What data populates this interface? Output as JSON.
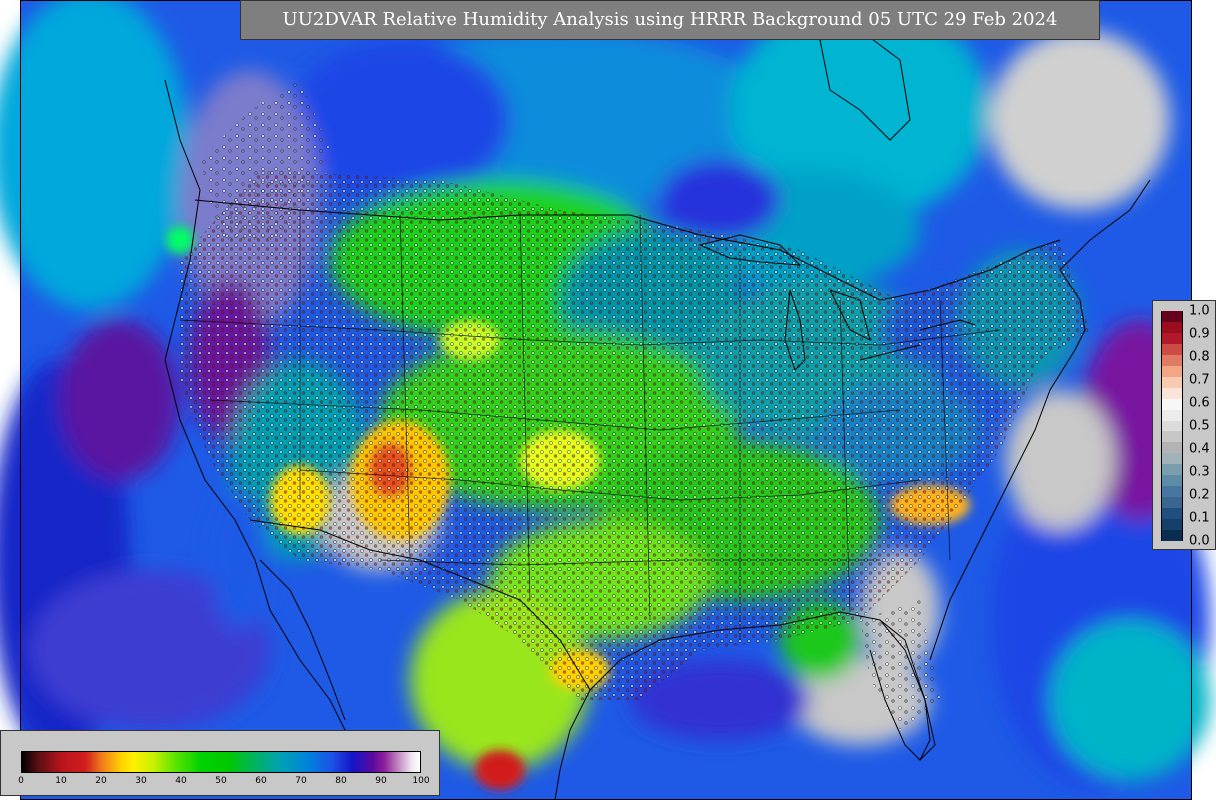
{
  "title": "UU2DVAR Relative Humidity Analysis using HRRR Background 05 UTC 29 Feb 2024",
  "rh_colorbar": {
    "ticks": [
      "0",
      "10",
      "20",
      "30",
      "40",
      "50",
      "60",
      "70",
      "80",
      "90",
      "100"
    ]
  },
  "increment_colorbar": {
    "labels": [
      "1.0",
      "0.9",
      "0.8",
      "0.7",
      "0.6",
      "0.5",
      "0.4",
      "0.3",
      "0.2",
      "0.1",
      "0.0"
    ],
    "colors": [
      "#67001f",
      "#9c0d1c",
      "#b2182b",
      "#cc4c45",
      "#e07b63",
      "#f4a582",
      "#f8cbb0",
      "#fae4d8",
      "#f7f7f7",
      "#ececec",
      "#dcdcdc",
      "#c7c7c7",
      "#b3b3b3",
      "#9fb3b8",
      "#7a9eae",
      "#5e8ca6",
      "#4776a0",
      "#3a6690",
      "#1f4f7f",
      "#163f6a",
      "#0c2d52"
    ]
  },
  "colors": {
    "ocean_blue": "#1e64e6",
    "ocean_cyan": "#00aadc",
    "ocean_purple": "#6a14a0",
    "dry_gray": "#c8c8c8",
    "moist_green": "#1ed21e",
    "teal": "#0096a0",
    "dry_yellow": "#ffd200",
    "very_dry_red": "#d21f1f"
  }
}
